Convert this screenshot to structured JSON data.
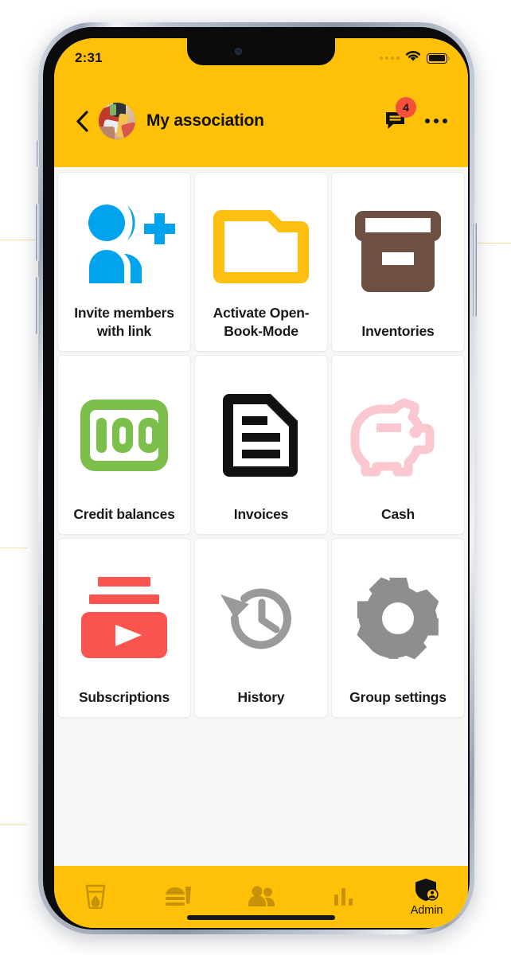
{
  "status_bar": {
    "time": "2:31",
    "signal_icon": "signal-dots-icon",
    "wifi_icon": "wifi-icon",
    "battery_icon": "battery-full-icon"
  },
  "app_bar": {
    "back_icon": "back-chevron-icon",
    "avatar_icon": "group-avatar-image",
    "title": "My association",
    "chat_icon": "chat-bubble-icon",
    "chat_badge_count": "4",
    "more_icon": "more-options-icon"
  },
  "colors": {
    "brand_yellow": "#FFC107",
    "badge_red": "#F4513B",
    "tile_background": "#FFFFFF",
    "page_background": "#F7F7F7",
    "invite_blue": "#00A3EC",
    "openbook_yellow": "#FDC010",
    "inventory_brown": "#6E4F44",
    "credit_green": "#7CBF4B",
    "invoice_black": "#111111",
    "cash_pink": "#FBC8D2",
    "subscription_red": "#FB5350",
    "history_gray": "#9A9A9A",
    "settings_gray": "#8E8E8E",
    "tab_inactive": "#C79206",
    "tab_active": "#111111"
  },
  "grid": {
    "tiles": [
      {
        "id": "invite-members",
        "label": "Invite members with link",
        "icon": "person-add-icon"
      },
      {
        "id": "activate-open-book-mode",
        "label": "Activate Open-Book-Mode",
        "icon": "open-folder-icon"
      },
      {
        "id": "inventories",
        "label": "Inventories",
        "icon": "archive-box-icon"
      },
      {
        "id": "credit-balances",
        "label": "Credit balances",
        "icon": "hundred-credits-icon"
      },
      {
        "id": "invoices",
        "label": "Invoices",
        "icon": "document-lines-icon"
      },
      {
        "id": "cash",
        "label": "Cash",
        "icon": "piggy-bank-icon"
      },
      {
        "id": "subscriptions",
        "label": "Subscriptions",
        "icon": "subscriptions-play-icon"
      },
      {
        "id": "history",
        "label": "History",
        "icon": "history-clock-icon"
      },
      {
        "id": "group-settings",
        "label": "Group settings",
        "icon": "gear-icon"
      }
    ]
  },
  "tab_bar": {
    "tabs": [
      {
        "id": "drinks",
        "label": "",
        "icon": "drink-glass-icon",
        "active": false
      },
      {
        "id": "food",
        "label": "",
        "icon": "fast-food-icon",
        "active": false
      },
      {
        "id": "members",
        "label": "",
        "icon": "people-icon",
        "active": false
      },
      {
        "id": "statistics",
        "label": "",
        "icon": "bar-chart-icon",
        "active": false
      },
      {
        "id": "admin",
        "label": "Admin",
        "icon": "admin-shield-icon",
        "active": true
      }
    ]
  }
}
